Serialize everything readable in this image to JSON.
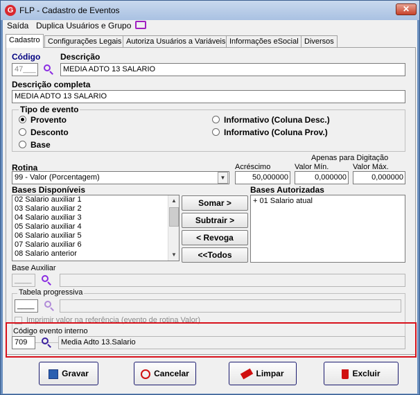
{
  "window": {
    "title": "FLP - Cadastro de Eventos",
    "close_glyph": "✕",
    "logo_letter": "G"
  },
  "menu": {
    "saida": "Saída",
    "duplica": "Duplica Usuários e Grupo"
  },
  "tabs": [
    "Cadastro",
    "Configurações Legais",
    "Autoriza Usuários a Variáveis",
    "Informações eSocial",
    "Diversos"
  ],
  "form": {
    "codigo_label": "Código",
    "codigo_value": "47___",
    "descricao_label": "Descrição",
    "descricao_value": "MEDIA ADTO 13 SALARIO",
    "desc_completa_label": "Descrição completa",
    "desc_completa_value": "MEDIA ADTO 13 SALARIO",
    "tipo_evento_label": "Tipo de evento",
    "tipo_options": [
      "Provento",
      "Desconto",
      "Base",
      "Informativo (Coluna Desc.)",
      "Informativo (Coluna Prov.)"
    ],
    "tipo_selected": "Provento",
    "rotina_label": "Rotina",
    "rotina_value": "99 - Valor (Porcentagem)",
    "apenas_label": "Apenas para Digitação",
    "acrescimo_label": "Acréscimo",
    "acrescimo_value": "50,000000",
    "valor_min_label": "Valor Mín.",
    "valor_min_value": "0,000000",
    "valor_max_label": "Valor Máx.",
    "valor_max_value": "0,000000",
    "bases_disponiveis_label": "Bases Disponíveis",
    "bases_disponiveis": [
      "02 Salario auxiliar 1",
      "03 Salario auxiliar 2",
      "04 Salario auxiliar 3",
      "05 Salario auxiliar 4",
      "06 Salario auxiliar 5",
      "07 Salario auxiliar 6",
      "08 Salario anterior"
    ],
    "bases_autorizadas_label": "Bases Autorizadas",
    "bases_autorizadas": [
      "+ 01 Salario atual"
    ],
    "btn_somar": "Somar >",
    "btn_subtrair": "Subtrair >",
    "btn_revoga": "< Revoga",
    "btn_todos": "<<Todos",
    "base_auxiliar_label": "Base Auxiliar",
    "base_auxiliar_value": "____",
    "tabela_progressiva_label": "Tabela progressiva",
    "tabela_value": "____",
    "imprimir_label": "Imprimir valor na referência (evento de rotina Valor)",
    "codigo_interno_label": "Código evento interno",
    "codigo_interno_value": "709",
    "codigo_interno_desc": "Media Adto 13.Salario"
  },
  "buttons": {
    "gravar": "Gravar",
    "cancelar": "Cancelar",
    "limpar": "Limpar",
    "excluir": "Excluir"
  },
  "colors": {
    "highlight_box": "#d8111b",
    "search_icon": "#8a2be2",
    "label_navy": "#000080"
  }
}
